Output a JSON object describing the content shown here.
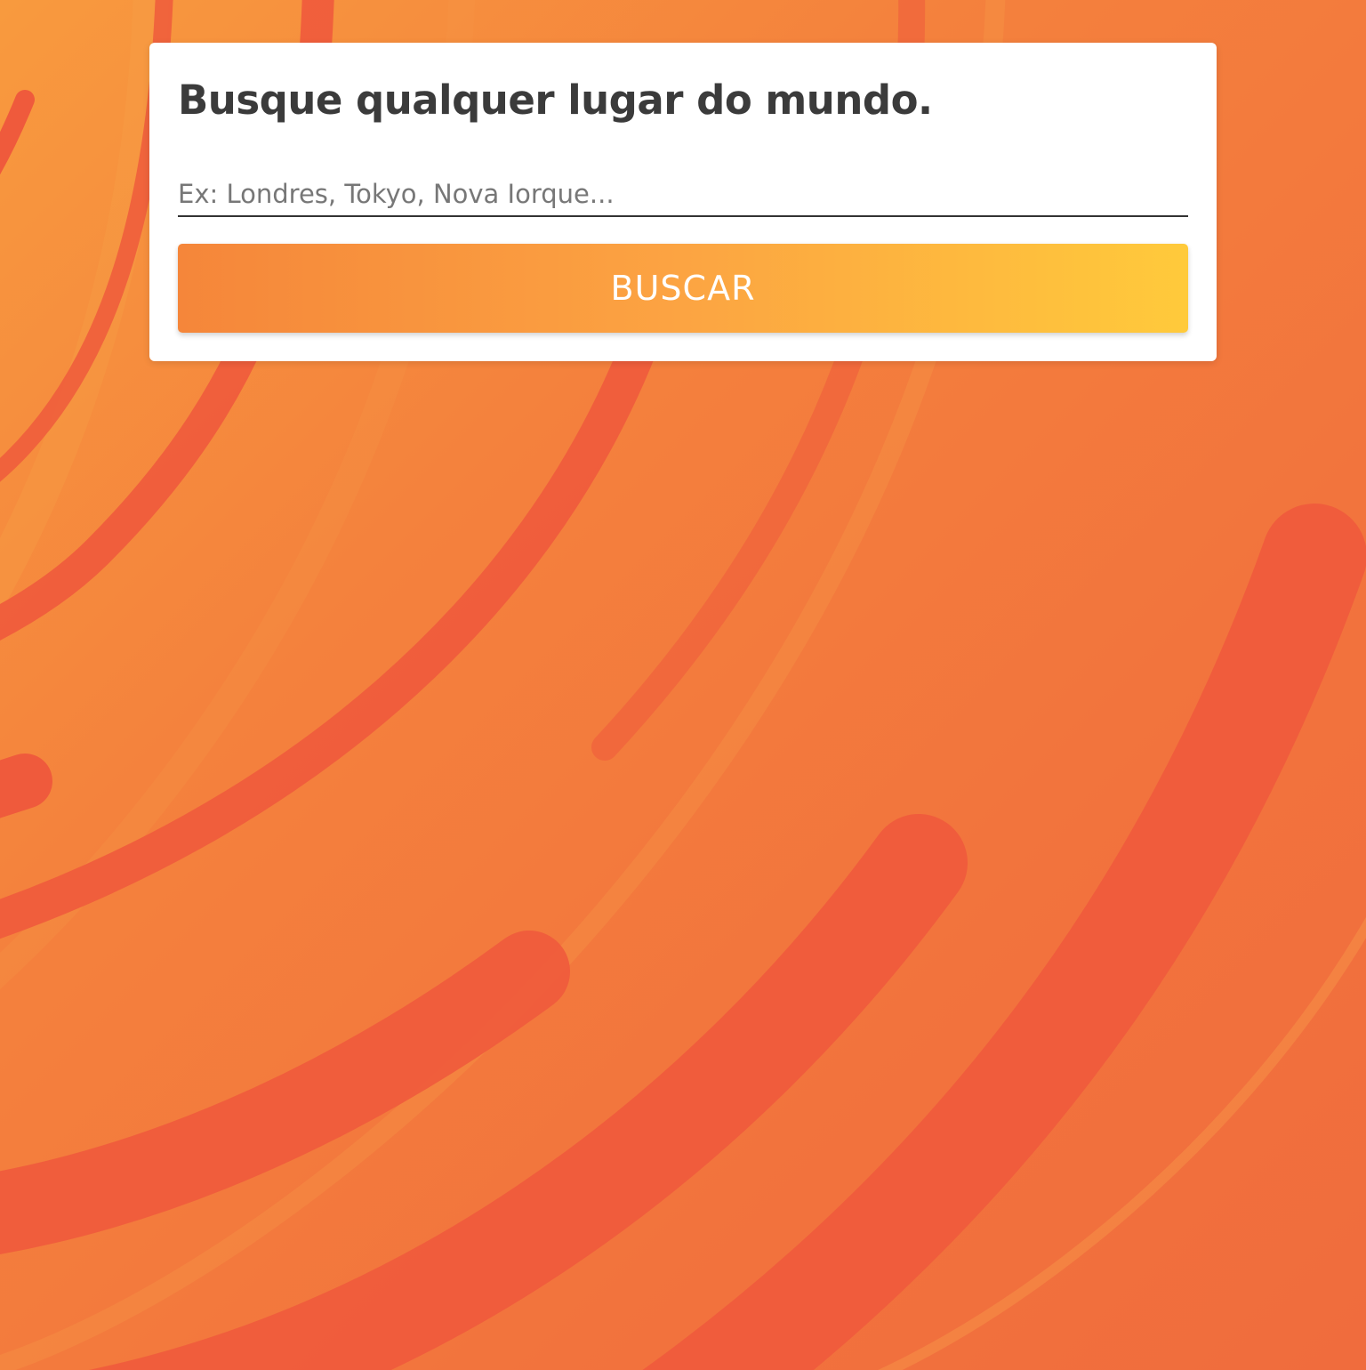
{
  "search_card": {
    "title": "Busque qualquer lugar do mundo.",
    "input": {
      "value": "",
      "placeholder": "Ex: Londres, Tokyo, Nova Iorque..."
    },
    "button_label": "BUSCAR"
  },
  "colors": {
    "background_start": "#f89a3e",
    "background_end": "#f06c3d",
    "stroke_accent": "#ef5a3c",
    "title_text": "#3b3b3b",
    "button_gradient_start": "#f5863a",
    "button_gradient_end": "#ffca3b",
    "button_text": "#ffffff"
  }
}
